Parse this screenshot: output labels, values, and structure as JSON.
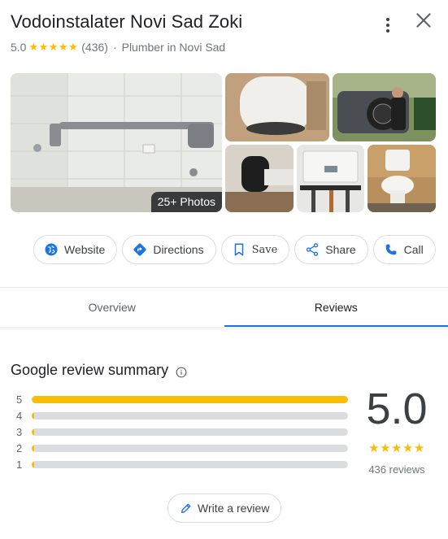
{
  "place": {
    "name": "Vodoinstalater Novi Sad Zoki",
    "rating": "5.0",
    "stars": "★★★★★",
    "review_count": "(436)",
    "separator": "·",
    "category": "Plumber in Novi Sad"
  },
  "photos": {
    "badge": "25+ Photos"
  },
  "actions": [
    {
      "label": "Website",
      "icon": "globe-icon"
    },
    {
      "label": "Directions",
      "icon": "directions-icon"
    },
    {
      "label": "Save",
      "icon": "bookmark-icon"
    },
    {
      "label": "Share",
      "icon": "share-icon"
    },
    {
      "label": "Call",
      "icon": "phone-icon"
    }
  ],
  "tabs": [
    {
      "label": "Overview",
      "active": false
    },
    {
      "label": "Reviews",
      "active": true
    }
  ],
  "review_summary": {
    "title": "Google review summary",
    "distribution": [
      {
        "stars": "5",
        "fraction": 1.0
      },
      {
        "stars": "4",
        "fraction": 0.0
      },
      {
        "stars": "3",
        "fraction": 0.0
      },
      {
        "stars": "2",
        "fraction": 0.0
      },
      {
        "stars": "1",
        "fraction": 0.0
      }
    ],
    "score": "5.0",
    "score_stars": "★★★★★",
    "total_reviews": "436 reviews"
  },
  "write_review": {
    "label": "Write a review"
  },
  "colors": {
    "star": "#fbbc04",
    "accent": "#1a73e8",
    "bar_track": "#dadce0"
  }
}
